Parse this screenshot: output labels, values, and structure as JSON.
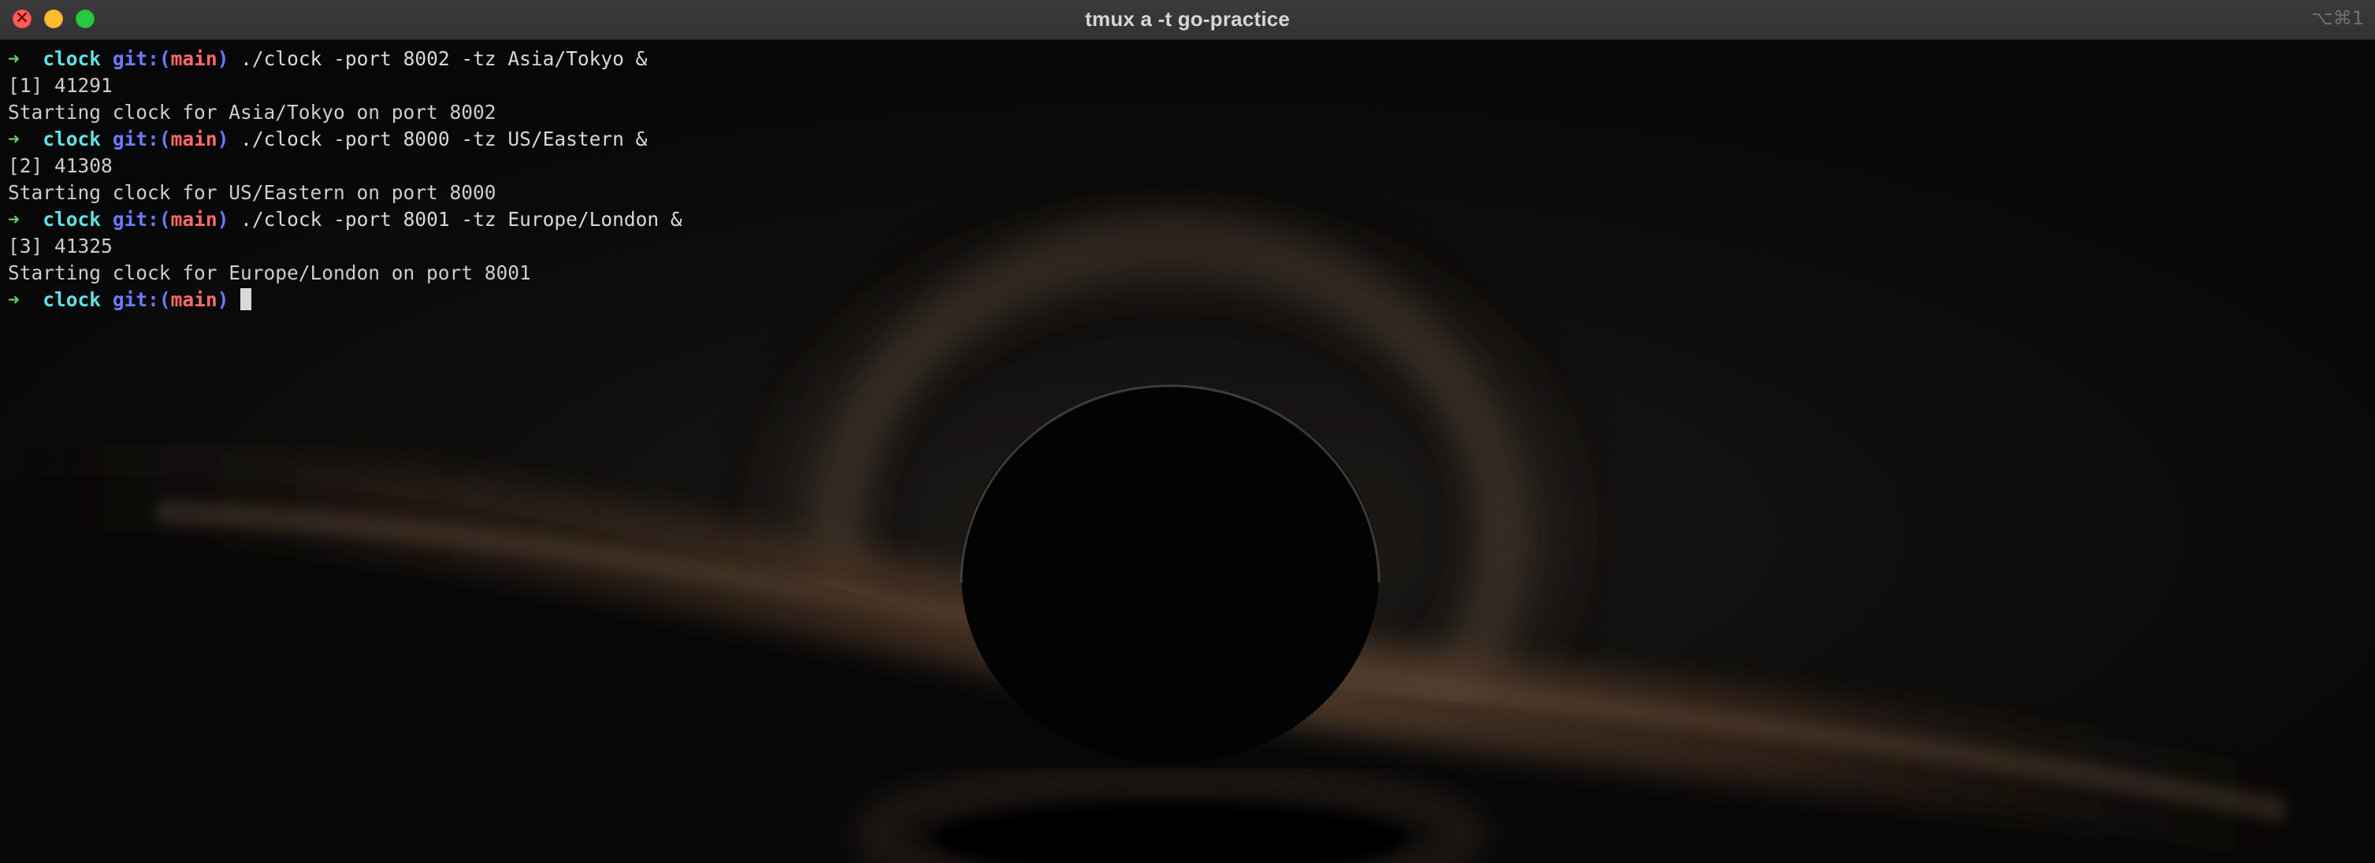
{
  "window": {
    "title": "tmux a -t go-practice",
    "shortcut": "⌥⌘1"
  },
  "colors": {
    "prompt_arrow": "#5fd35f",
    "prompt_dir": "#5ee2e2",
    "git_label": "#6b7bff",
    "branch": "#ff6a6a",
    "text": "#cfcfcf"
  },
  "prompt": {
    "arrow": "➜",
    "dir": "clock",
    "git_open": "git:(",
    "branch": "main",
    "git_close": ")"
  },
  "terminal": {
    "lines": [
      {
        "type": "prompt",
        "command": "./clock -port 8002 -tz Asia/Tokyo &"
      },
      {
        "type": "output",
        "text": "[1] 41291"
      },
      {
        "type": "output",
        "text": "Starting clock for Asia/Tokyo on port 8002"
      },
      {
        "type": "prompt",
        "command": "./clock -port 8000 -tz US/Eastern &"
      },
      {
        "type": "output",
        "text": "[2] 41308"
      },
      {
        "type": "output",
        "text": "Starting clock for US/Eastern on port 8000"
      },
      {
        "type": "prompt",
        "command": "./clock -port 8001 -tz Europe/London &"
      },
      {
        "type": "output",
        "text": "[3] 41325"
      },
      {
        "type": "output",
        "text": "Starting clock for Europe/London on port 8001"
      },
      {
        "type": "prompt",
        "command": ""
      }
    ]
  }
}
